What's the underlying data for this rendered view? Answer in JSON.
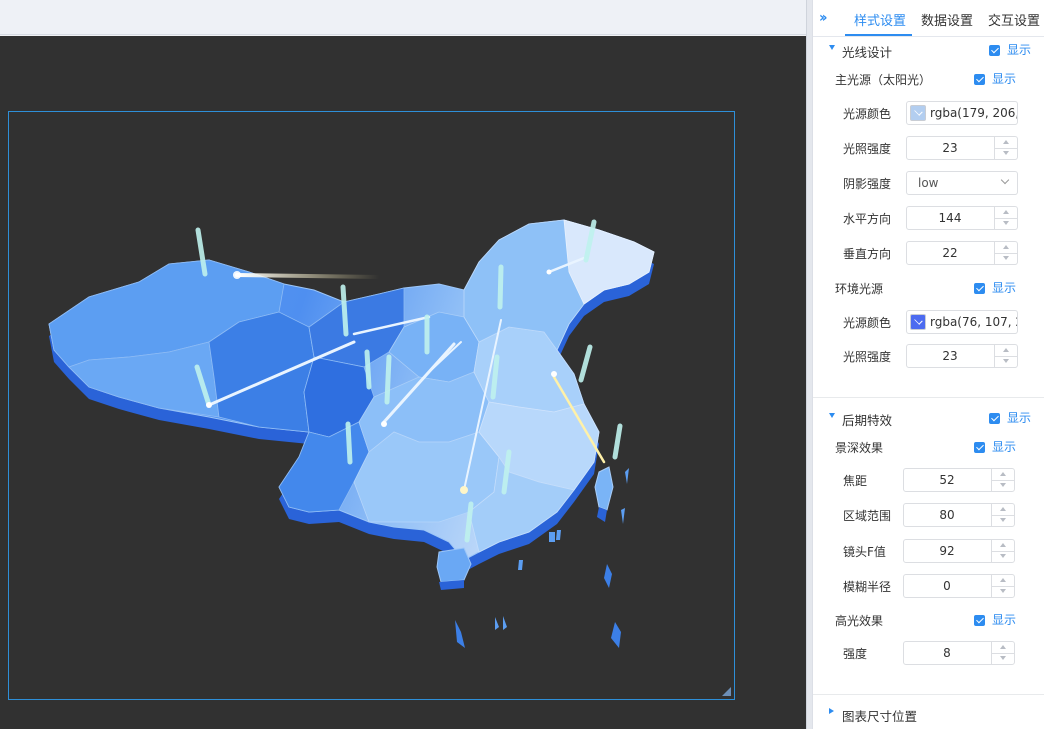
{
  "tabs": [
    {
      "label": "样式设置",
      "active": true
    },
    {
      "label": "数据设置",
      "active": false
    },
    {
      "label": "交互设置",
      "active": false
    }
  ],
  "accent_color": "#2d8cf0",
  "canvas_bg": "#313131",
  "light_design": {
    "title": "光线设计",
    "show_label": "显示",
    "enabled": true,
    "main_light": {
      "title": "主光源（太阳光）",
      "show_label": "显示",
      "enabled": true,
      "color_label": "光源颜色",
      "color_value": "rgba(179, 206, 2",
      "color_swatch": "#b3cef0",
      "intensity_label": "光照强度",
      "intensity_value": "23",
      "shadow_label": "阴影强度",
      "shadow_value": "low",
      "horizontal_label": "水平方向",
      "horizontal_value": "144",
      "vertical_label": "垂直方向",
      "vertical_value": "22"
    },
    "ambient_light": {
      "title": "环境光源",
      "show_label": "显示",
      "enabled": true,
      "color_label": "光源颜色",
      "color_value": "rgba(76, 107, 24",
      "color_swatch": "#4c6bf0",
      "intensity_label": "光照强度",
      "intensity_value": "23"
    }
  },
  "post_effects": {
    "title": "后期特效",
    "show_label": "显示",
    "enabled": true,
    "dof": {
      "title": "景深效果",
      "show_label": "显示",
      "enabled": true,
      "focal_label": "焦距",
      "focal_value": "52",
      "range_label": "区域范围",
      "range_value": "80",
      "fstop_label": "镜头F值",
      "fstop_value": "92",
      "blur_label": "模糊半径",
      "blur_value": "0"
    },
    "bloom": {
      "title": "高光效果",
      "show_label": "显示",
      "enabled": true,
      "strength_label": "强度",
      "strength_value": "8"
    }
  },
  "chart_size": {
    "title": "图表尺寸位置"
  }
}
